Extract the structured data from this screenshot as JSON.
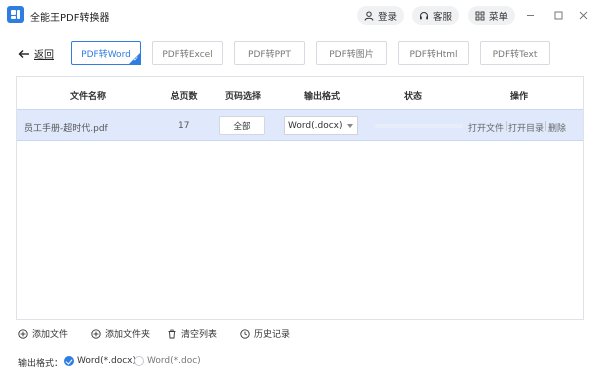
{
  "app": {
    "title": "全能王PDF转换器",
    "login": "登录",
    "service": "客服",
    "menu": "菜单"
  },
  "toolbar": {
    "back": "返回",
    "tabs": [
      "PDF转Word",
      "PDF转Excel",
      "PDF转PPT",
      "PDF转图片",
      "PDF转Html",
      "PDF转Text"
    ],
    "active_tab": "PDF转Word"
  },
  "table": {
    "headers": {
      "file_name": "文件名称",
      "total_pages": "总页数",
      "page_select": "页码选择",
      "output_format": "输出格式",
      "status": "状态",
      "actions": "操作"
    },
    "rows": [
      {
        "file_name": "员工手册-超时代.pdf",
        "total_pages": "17",
        "page_select": "全部",
        "output_format": "Word(.docx)",
        "progress": 0,
        "open_file": "打开文件",
        "open_dir": "打开目录",
        "delete": "删除"
      }
    ]
  },
  "bottom": {
    "add_file": "添加文件",
    "add_folder": "添加文件夹",
    "clear_list": "清空列表",
    "history": "历史记录",
    "format_label": "输出格式：",
    "options": [
      "Word(*.docx)",
      "Word(*.doc)"
    ],
    "selected": "Word(*.docx)"
  },
  "colors": {
    "accent": "#2f7de1",
    "row_selected": "#dfe9fb"
  }
}
